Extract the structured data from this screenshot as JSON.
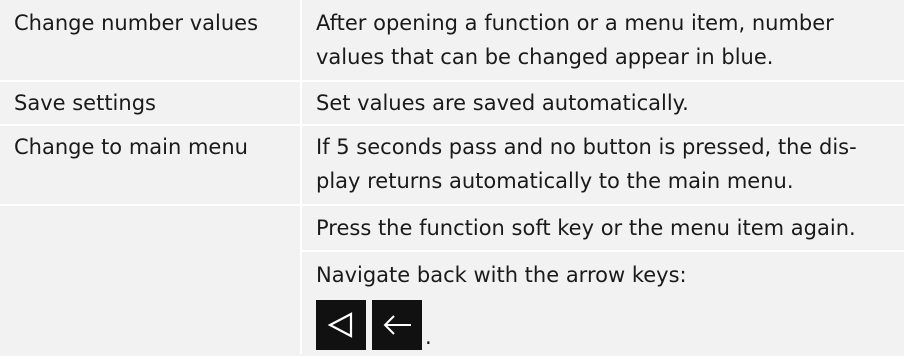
{
  "rows": [
    {
      "label": "Change number values",
      "desc_lines": [
        "After opening a function or a menu item, number",
        "values that can be changed appear in blue."
      ]
    },
    {
      "label": "Save settings",
      "desc_lines": [
        "Set values are saved automatically."
      ]
    },
    {
      "label": "Change to main menu",
      "desc_lines": [
        "If 5 seconds pass and no button is pressed, the dis-",
        "play returns automatically to the main menu."
      ]
    },
    {
      "label": "",
      "desc_lines": [
        "Press the function soft key or the menu item again."
      ]
    },
    {
      "label": "",
      "desc_lines": [
        "Navigate back with the arrow keys:"
      ],
      "keys": [
        "triangle-left-icon",
        "arrow-left-icon"
      ],
      "suffix": "."
    }
  ],
  "colors": {
    "cell_bg": "#f2f2f2",
    "separator": "#ffffff",
    "key_bg": "#111111",
    "key_glyph": "#ffffff"
  }
}
